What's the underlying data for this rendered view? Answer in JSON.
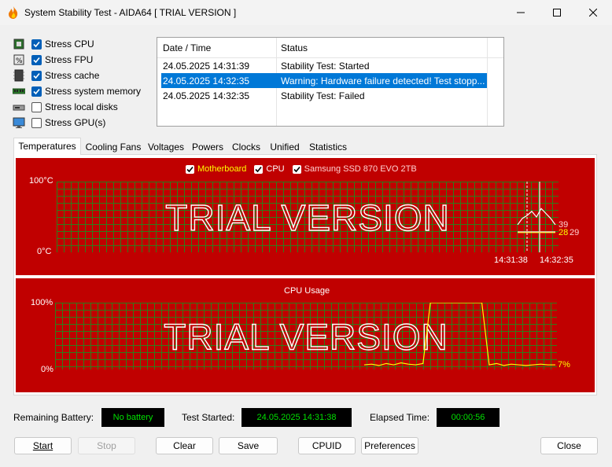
{
  "window": {
    "title": "System Stability Test - AIDA64  [ TRIAL VERSION ]"
  },
  "stress_options": [
    {
      "label": "Stress CPU",
      "checked": true,
      "icon": "cpu-icon"
    },
    {
      "label": "Stress FPU",
      "checked": true,
      "icon": "fpu-icon"
    },
    {
      "label": "Stress cache",
      "checked": true,
      "icon": "cache-icon"
    },
    {
      "label": "Stress system memory",
      "checked": true,
      "icon": "memory-icon"
    },
    {
      "label": "Stress local disks",
      "checked": false,
      "icon": "disk-icon"
    },
    {
      "label": "Stress GPU(s)",
      "checked": false,
      "icon": "monitor-icon"
    }
  ],
  "log": {
    "headers": [
      "Date / Time",
      "Status"
    ],
    "rows": [
      {
        "datetime": "24.05.2025 14:31:39",
        "status": "Stability Test: Started",
        "selected": false
      },
      {
        "datetime": "24.05.2025 14:32:35",
        "status": "Warning: Hardware failure detected! Test stopp...",
        "selected": true
      },
      {
        "datetime": "24.05.2025 14:32:35",
        "status": "Stability Test: Failed",
        "selected": false
      }
    ]
  },
  "tabs": [
    "Temperatures",
    "Cooling Fans",
    "Voltages",
    "Powers",
    "Clocks",
    "Unified",
    "Statistics"
  ],
  "active_tab": "Temperatures",
  "temperature_graph": {
    "legend": [
      {
        "label": "Motherboard",
        "checked": true,
        "color": "#ffff00"
      },
      {
        "label": "CPU",
        "checked": true,
        "color": "#ffffff"
      },
      {
        "label": "Samsung SSD 870 EVO 2TB",
        "checked": true,
        "color": "#ffd0d0"
      }
    ],
    "y_max_label": "100°C",
    "y_min_label": "0°C",
    "watermark": "TRIAL VERSION",
    "time_start": "14:31:38",
    "time_end": "14:32:35",
    "value_labels": {
      "cpu": "39",
      "motherboard": "28",
      "ssd": "29"
    }
  },
  "cpu_graph": {
    "title": "CPU Usage",
    "y_max_label": "100%",
    "y_min_label": "0%",
    "watermark": "TRIAL VERSION",
    "value_label": "7%"
  },
  "chart_data": [
    {
      "type": "line",
      "title": "",
      "ylim": [
        0,
        100
      ],
      "x": [
        "14:31:38",
        "14:32:35"
      ],
      "series": [
        {
          "name": "Motherboard",
          "color": "#ffff00",
          "values": [
            28,
            28,
            28
          ]
        },
        {
          "name": "CPU",
          "color": "#ffffff",
          "values": [
            39,
            48,
            52,
            58,
            50,
            62,
            55,
            48,
            39
          ]
        },
        {
          "name": "Samsung SSD 870 EVO 2TB",
          "color": "#ffd0d0",
          "values": [
            29,
            29,
            29
          ]
        }
      ]
    },
    {
      "type": "line",
      "title": "CPU Usage",
      "ylim": [
        0,
        100
      ],
      "series": [
        {
          "name": "CPU Usage",
          "color": "#ffff00",
          "values": [
            7,
            8,
            6,
            9,
            7,
            10,
            8,
            7,
            9,
            100,
            100,
            100,
            100,
            100,
            100,
            100,
            100,
            7,
            9,
            6,
            8,
            7,
            6,
            7,
            8,
            7,
            7
          ]
        }
      ]
    }
  ],
  "info": {
    "battery_label": "Remaining Battery:",
    "battery_value": "No battery",
    "started_label": "Test Started:",
    "started_value": "24.05.2025 14:31:38",
    "elapsed_label": "Elapsed Time:",
    "elapsed_value": "00:00:56"
  },
  "buttons": {
    "start": "Start",
    "stop": "Stop",
    "clear": "Clear",
    "save": "Save",
    "cpuid": "CPUID",
    "preferences": "Preferences",
    "close": "Close"
  }
}
